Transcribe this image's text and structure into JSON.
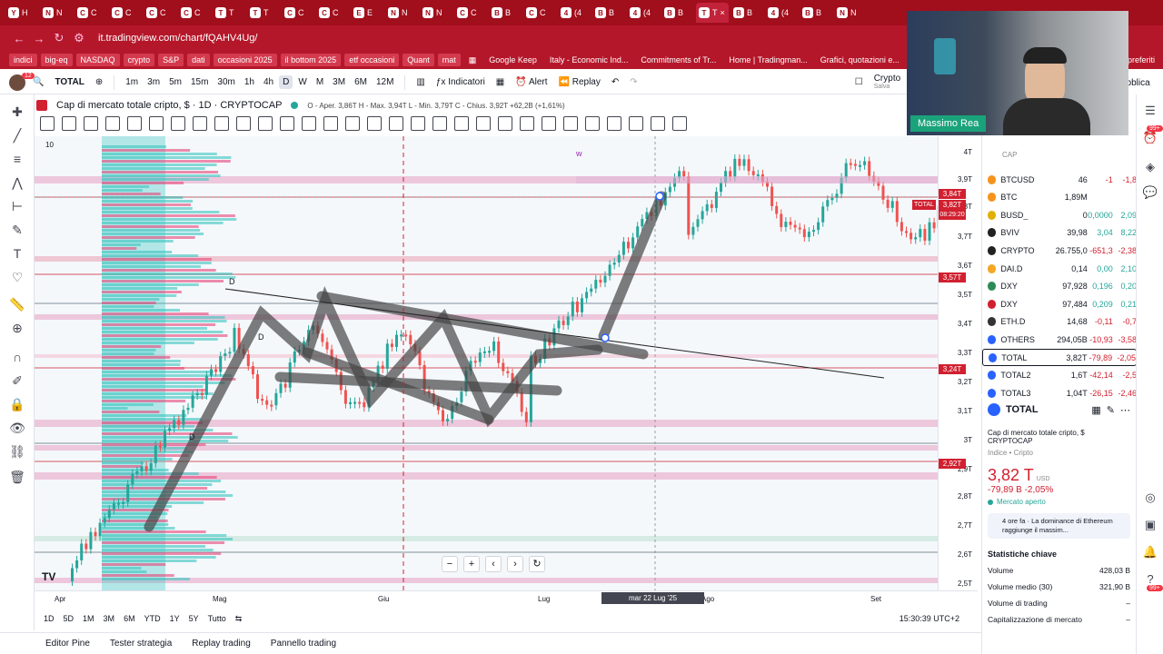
{
  "browser": {
    "tabs": [
      {
        "label": "H",
        "fav": "Y"
      },
      {
        "label": "N",
        "fav": "N"
      },
      {
        "label": "C",
        "fav": "C"
      },
      {
        "label": "C",
        "fav": "C"
      },
      {
        "label": "C",
        "fav": "C"
      },
      {
        "label": "C",
        "fav": "C"
      },
      {
        "label": "T",
        "fav": "T"
      },
      {
        "label": "T",
        "fav": "T"
      },
      {
        "label": "C",
        "fav": "C"
      },
      {
        "label": "C",
        "fav": "C"
      },
      {
        "label": "E",
        "fav": "E"
      },
      {
        "label": "N",
        "fav": "N"
      },
      {
        "label": "N",
        "fav": "N"
      },
      {
        "label": "C",
        "fav": "C"
      },
      {
        "label": "B",
        "fav": "B"
      },
      {
        "label": "C",
        "fav": "C"
      },
      {
        "label": "(4",
        "fav": "4"
      },
      {
        "label": "B",
        "fav": "B"
      },
      {
        "label": "(4",
        "fav": "4"
      },
      {
        "label": "B",
        "fav": "B"
      },
      {
        "label": "T",
        "fav": "T",
        "active": true
      },
      {
        "label": "B",
        "fav": "B"
      },
      {
        "label": "(4",
        "fav": "4"
      },
      {
        "label": "B",
        "fav": "B"
      },
      {
        "label": "N",
        "fav": "N"
      }
    ],
    "url": "it.tradingview.com/chart/fQAHV4Ug/",
    "bookmarks": [
      "indici",
      "big-eq",
      "NASDAQ",
      "crypto",
      "S&P",
      "dati",
      "occasioni 2025",
      "il bottom 2025",
      "etf occasioni",
      "Quant",
      "mat"
    ],
    "bookmarks_plain": [
      "Google Keep",
      "Italy - Economic Ind...",
      "Commitments of Tr...",
      "Home | Tradingman...",
      "Grafici, quotazioni e...",
      "preferiti"
    ]
  },
  "header": {
    "symbol": "TOTAL",
    "intervals": [
      "1m",
      "3m",
      "5m",
      "15m",
      "30m",
      "1h",
      "4h",
      "D",
      "W",
      "M",
      "3M",
      "6M",
      "12M"
    ],
    "indicators": "Indicatori",
    "alert": "Alert",
    "replay": "Replay",
    "crypto_label": "Crypto",
    "salva": "Salva",
    "pubblica": "ubblica"
  },
  "legend": {
    "title": "Cap di mercato totale cripto, $ · 1D · CRYPTOCAP",
    "ohlc": "O - Aper. 3,86T  H - Max. 3,94T  L - Min. 3,79T  C - Chius. 3,92T  +62,2B (+1,61%)",
    "count": "10"
  },
  "price_axis": {
    "ticks": [
      "4T",
      "3,9T",
      "3,8T",
      "3,7T",
      "3,6T",
      "3,5T",
      "3,4T",
      "3,3T",
      "3,2T",
      "3,1T",
      "3T",
      "2,9T",
      "2,8T",
      "2,7T",
      "2,6T",
      "2,5T"
    ],
    "tags": [
      {
        "label": "3,84T",
        "color": "#d12030"
      },
      {
        "label": "3,82T",
        "color": "#d12030"
      },
      {
        "label": "3,57T",
        "color": "#d12030"
      },
      {
        "label": "3,24T",
        "color": "#d12030"
      },
      {
        "label": "2,92T",
        "color": "#d12030"
      }
    ],
    "countdown": "08:29:20",
    "total_tag": "TOTAL"
  },
  "time_axis": {
    "ticks": [
      "Apr",
      "Mag",
      "Giu",
      "Lug",
      "Ago",
      "Set"
    ],
    "crosshair": "mar 22 Lug '25",
    "clock": "15:30:39 UTC+2"
  },
  "periods": [
    "1D",
    "5D",
    "1M",
    "3M",
    "6M",
    "YTD",
    "1Y",
    "5Y",
    "Tutto"
  ],
  "bottom_tabs": [
    "Editor Pine",
    "Tester strategia",
    "Replay trading",
    "Pannello trading"
  ],
  "chart_labels": {
    "d1": "D",
    "d2": "D",
    "d3": "D",
    "w": "w",
    "tv": "TV"
  },
  "watchlist": {
    "header": "CAP",
    "rows": [
      {
        "sym": "BTCUSD",
        "last": "46",
        "chg": "-1",
        "pct": "-1,8",
        "color": "#f7931a"
      },
      {
        "sym": "BTC",
        "last": "1,89M",
        "chg": "",
        "pct": "",
        "color": "#f7931a"
      },
      {
        "sym": "BUSD_",
        "last": "0",
        "chg": "0,0000",
        "pct": "2,09",
        "color": "#e0b000"
      },
      {
        "sym": "BVIV",
        "last": "39,98",
        "chg": "3,04",
        "pct": "8,22",
        "color": "#222"
      },
      {
        "sym": "CRYPTO",
        "last": "26.755,0",
        "chg": "-651,3",
        "pct": "-2,38",
        "color": "#222"
      },
      {
        "sym": "DAI.D",
        "last": "0,14",
        "chg": "0,00",
        "pct": "2,10",
        "color": "#f5a623"
      },
      {
        "sym": "DXY",
        "last": "97,928",
        "chg": "0,196",
        "pct": "0,20",
        "color": "#2e8b57"
      },
      {
        "sym": "DXY",
        "last": "97,484",
        "chg": "0,209",
        "pct": "0,21",
        "color": "#d12030"
      },
      {
        "sym": "ETH.D",
        "last": "14,68",
        "chg": "-0,11",
        "pct": "-0,7",
        "color": "#333"
      },
      {
        "sym": "OTHERS",
        "last": "294,05B",
        "chg": "-10,93",
        "pct": "-3,58",
        "color": "#2962ff"
      },
      {
        "sym": "TOTAL",
        "last": "3,82T",
        "chg": "-79,89",
        "pct": "-2,05",
        "color": "#2962ff"
      },
      {
        "sym": "TOTAL2",
        "last": "1,6T",
        "chg": "-42,14",
        "pct": "-2,5",
        "color": "#2962ff"
      },
      {
        "sym": "TOTAL3",
        "last": "1,04T",
        "chg": "-26,15",
        "pct": "-2,46",
        "color": "#2962ff"
      }
    ]
  },
  "details": {
    "symbol": "TOTAL",
    "name": "Cap di mercato totale cripto, $",
    "exchange": "CRYPTOCAP",
    "category": "Indice • Cripto",
    "price": "3,82 T",
    "currency": "USD",
    "change": "-79,89 B  -2,05%",
    "status": "Mercato aperto",
    "news": "4 ore fa · La dominance di Ethereum raggiunge il massim...",
    "stats_title": "Statistiche chiave",
    "stats": [
      {
        "label": "Volume",
        "value": "428,03 B"
      },
      {
        "label": "Volume medio (30)",
        "value": "321,90 B"
      },
      {
        "label": "Volume di trading",
        "value": "–"
      },
      {
        "label": "Capitalizzazione di mercato",
        "value": "–"
      }
    ]
  },
  "webcam": {
    "name": "Massimo Rea"
  },
  "notif": {
    "badge1": "99+",
    "badge2": "99+",
    "badge3": "12"
  }
}
